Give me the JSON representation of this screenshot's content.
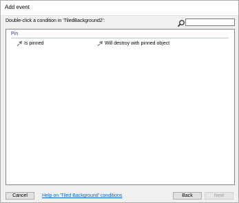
{
  "window": {
    "title": "Add event"
  },
  "prompt": "Double-click a condition in 'TiledBackground2':",
  "search": {
    "value": "",
    "placeholder": "",
    "icon": "search-icon"
  },
  "group": {
    "label": "Pin",
    "conditions": [
      {
        "label": "Is pinned",
        "icon": "pin-icon"
      },
      {
        "label": "Will destroy with pinned object",
        "icon": "pin-icon"
      }
    ]
  },
  "footer": {
    "cancel_label": "Cancel",
    "help_link": "Help on 'Tiled Background' conditions",
    "back_label": "Back",
    "next_label": "Next"
  },
  "colors": {
    "group_header": "#1e3287",
    "link": "#0066cc",
    "panel_bg": "#ffffff",
    "dialog_bg": "#f0f0f0"
  }
}
